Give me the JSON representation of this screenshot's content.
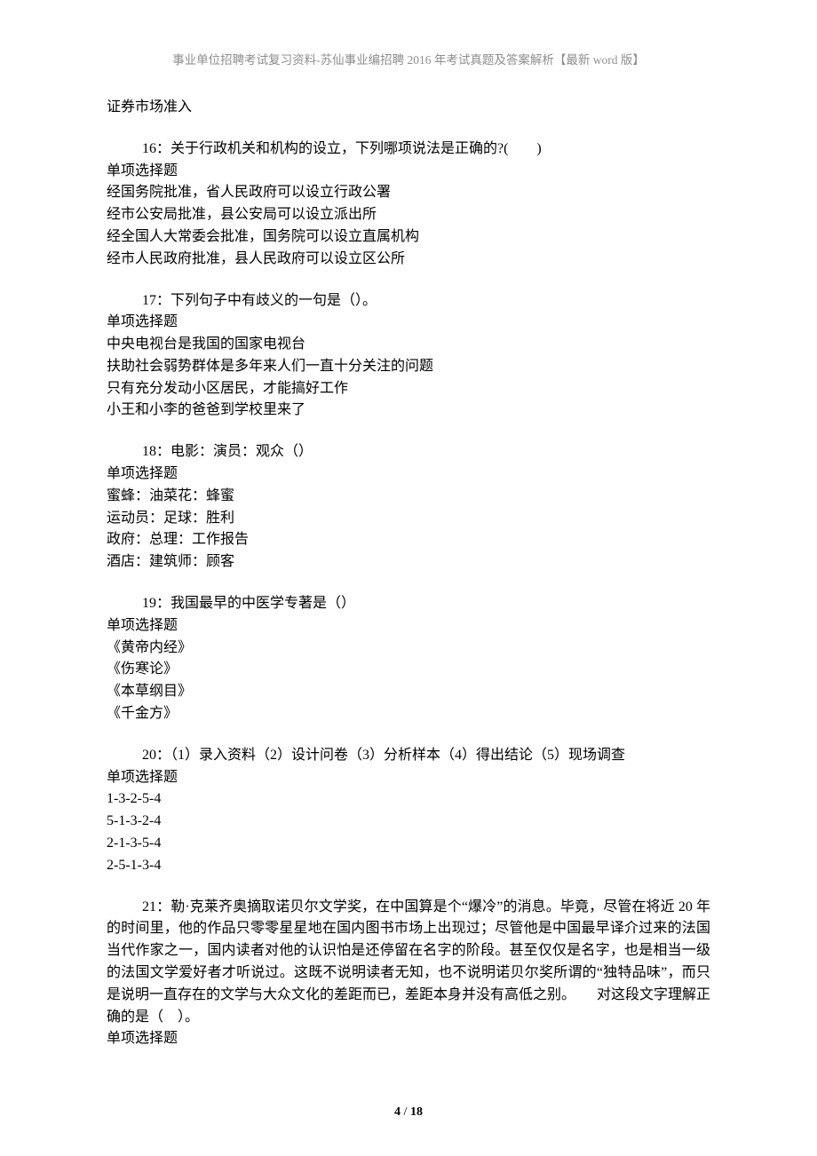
{
  "header": "事业单位招聘考试复习资料-苏仙事业编招聘 2016 年考试真题及答案解析【最新 word 版】",
  "orphan_line": "证券市场准入",
  "q16": {
    "lead": "16：关于行政机关和机构的设立，下列哪项说法是正确的?(　　)",
    "type": "单项选择题",
    "opts": [
      "经国务院批准，省人民政府可以设立行政公署",
      "经市公安局批准，县公安局可以设立派出所",
      "经全国人大常委会批准，国务院可以设立直属机构",
      "经市人民政府批准，县人民政府可以设立区公所"
    ]
  },
  "q17": {
    "lead": "17：下列句子中有歧义的一句是（）。",
    "type": "单项选择题",
    "opts": [
      "中央电视台是我国的国家电视台",
      "扶助社会弱势群体是多年来人们一直十分关注的问题",
      "只有充分发动小区居民，才能搞好工作",
      "小王和小李的爸爸到学校里来了"
    ]
  },
  "q18": {
    "lead": "18：电影：演员：观众（）",
    "type": "单项选择题",
    "opts": [
      "蜜蜂：油菜花：蜂蜜",
      "运动员：足球：胜利",
      "政府：总理：工作报告",
      "酒店：建筑师：顾客"
    ]
  },
  "q19": {
    "lead": "19：我国最早的中医学专著是（）",
    "type": "单项选择题",
    "opts": [
      "《黄帝内经》",
      "《伤寒论》",
      "《本草纲目》",
      "《千金方》"
    ]
  },
  "q20": {
    "lead": "20：（1）录入资料（2）设计问卷（3）分析样本（4）得出结论（5）现场调查",
    "type": "单项选择题",
    "opts": [
      "1-3-2-5-4",
      "5-1-3-2-4",
      "2-1-3-5-4",
      "2-5-1-3-4"
    ]
  },
  "q21": {
    "lead": "21：勒·克莱齐奥摘取诺贝尔文学奖，在中国算是个“爆冷”的消息。毕竟，尽管在将近 20 年的时间里，他的作品只零零星星地在国内图书市场上出现过；尽管他是中国最早译介过来的法国当代作家之一，国内读者对他的认识怕是还停留在名字的阶段。甚至仅仅是名字，也是相当一级的法国文学爱好者才听说过。这既不说明读者无知，也不说明诺贝尔奖所谓的“独特品味”，而只是说明一直存在的文学与大众文化的差距而已，差距本身并没有高低之别。　　对这段文字理解正确的是（　）。",
    "type": "单项选择题"
  },
  "footer": {
    "page": "4",
    "sep": " / ",
    "total": "18"
  }
}
